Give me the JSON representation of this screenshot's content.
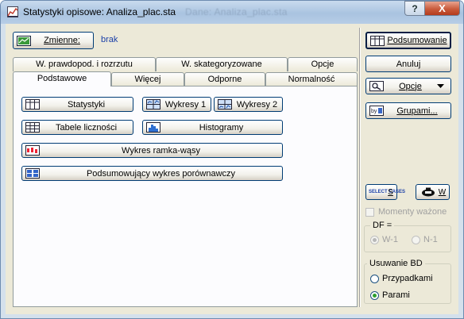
{
  "window": {
    "title": "Statystyki opisowe: Analiza_plac.sta",
    "background_title": "Dane: Analiza_plac.sta",
    "help_label": "?",
    "close_label": "X"
  },
  "variables": {
    "button_label": "Zmienne:",
    "value": "brak"
  },
  "tabs": {
    "row_back": [
      "W. prawdopod. i rozrzutu",
      "W. skategoryzowane",
      "Opcje"
    ],
    "row_front": [
      "Podstawowe",
      "Więcej",
      "Odporne",
      "Normalność"
    ],
    "active": "Podstawowe"
  },
  "main": {
    "statystyki": "Statystyki",
    "wykresy1": "Wykresy 1",
    "wykresy2": "Wykresy 2",
    "tabele": "Tabele liczności",
    "histogramy": "Histogramy",
    "ramka": "Wykres ramka-wąsy",
    "porownawczy": "Podsumowujący wykres porównawczy"
  },
  "side": {
    "podsumowanie": "Podsumowanie",
    "anuluj": "Anuluj",
    "opcje": "Opcje",
    "grupami": "Grupami...",
    "select_cases": "SELECT CASES",
    "select_s": "S",
    "weight_w": "W"
  },
  "moments": {
    "label": "Momenty ważone",
    "df_title": "DF =",
    "options": [
      "W-1",
      "N-1"
    ],
    "selected": "W-1"
  },
  "missing": {
    "title": "Usuwanie BD",
    "options": [
      "Przypadkami",
      "Parami"
    ],
    "selected": "Parami"
  }
}
